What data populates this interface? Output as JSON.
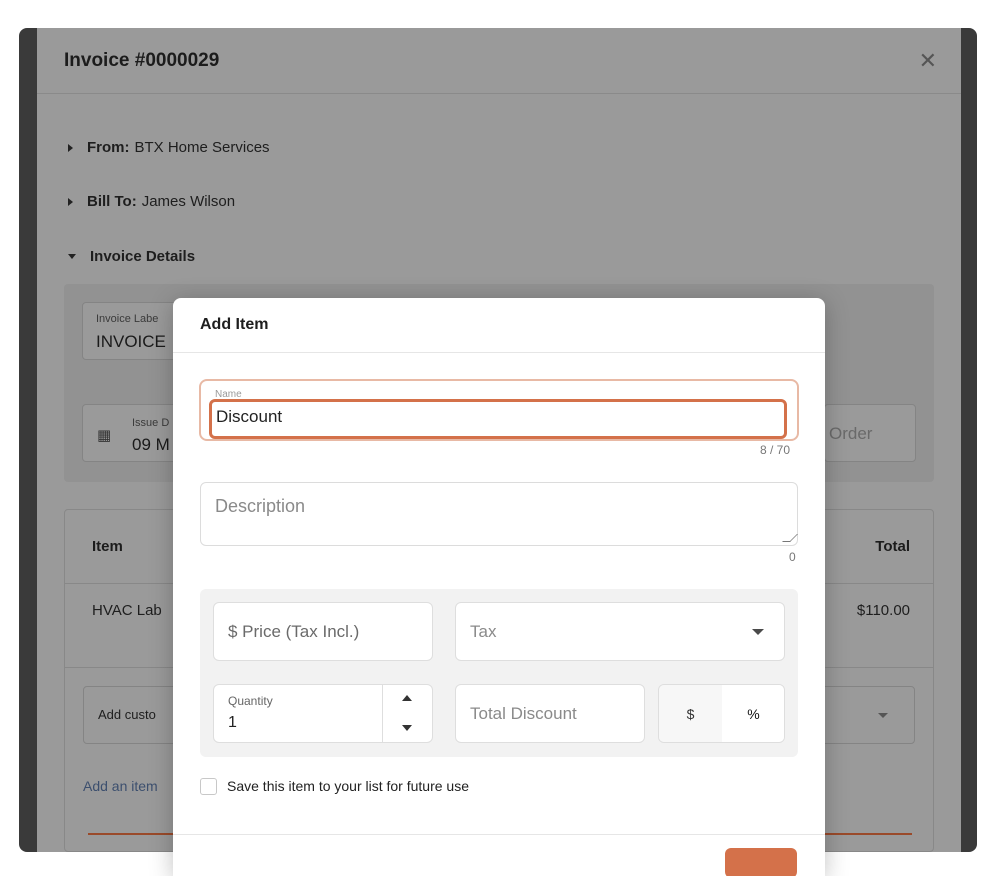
{
  "invoice": {
    "title": "Invoice #0000029",
    "from_label": "From:",
    "from_value": "BTX Home Services",
    "bill_to_label": "Bill To:",
    "bill_to_value": "James Wilson",
    "details_label": "Invoice Details",
    "invoice_label_caption": "Invoice Labe",
    "invoice_label_value": "INVOICE",
    "issue_date_caption": "Issue D",
    "issue_date_value": "09 M",
    "order_placeholder": "Order",
    "table": {
      "col_item": "Item",
      "col_total": "Total",
      "row_item": "HVAC Lab",
      "row_total": "$110.00",
      "add_customer": "Add custo",
      "add_item_link": "Add an item"
    }
  },
  "modal": {
    "title": "Add Item",
    "name_label": "Name",
    "name_value": "Discount",
    "name_counter": "8 / 70",
    "description_placeholder": "Description",
    "description_counter": "0",
    "price_placeholder": "$ Price (Tax Incl.)",
    "tax_placeholder": "Tax",
    "quantity_label": "Quantity",
    "quantity_value": "1",
    "total_discount_placeholder": "Total Discount",
    "discount_units": [
      "$",
      "%"
    ],
    "selected_discount_unit": "%",
    "save_item_label": "Save this item to your list for future use"
  },
  "colors": {
    "accent": "#d4714a",
    "accent_light": "#e8b9a5"
  }
}
